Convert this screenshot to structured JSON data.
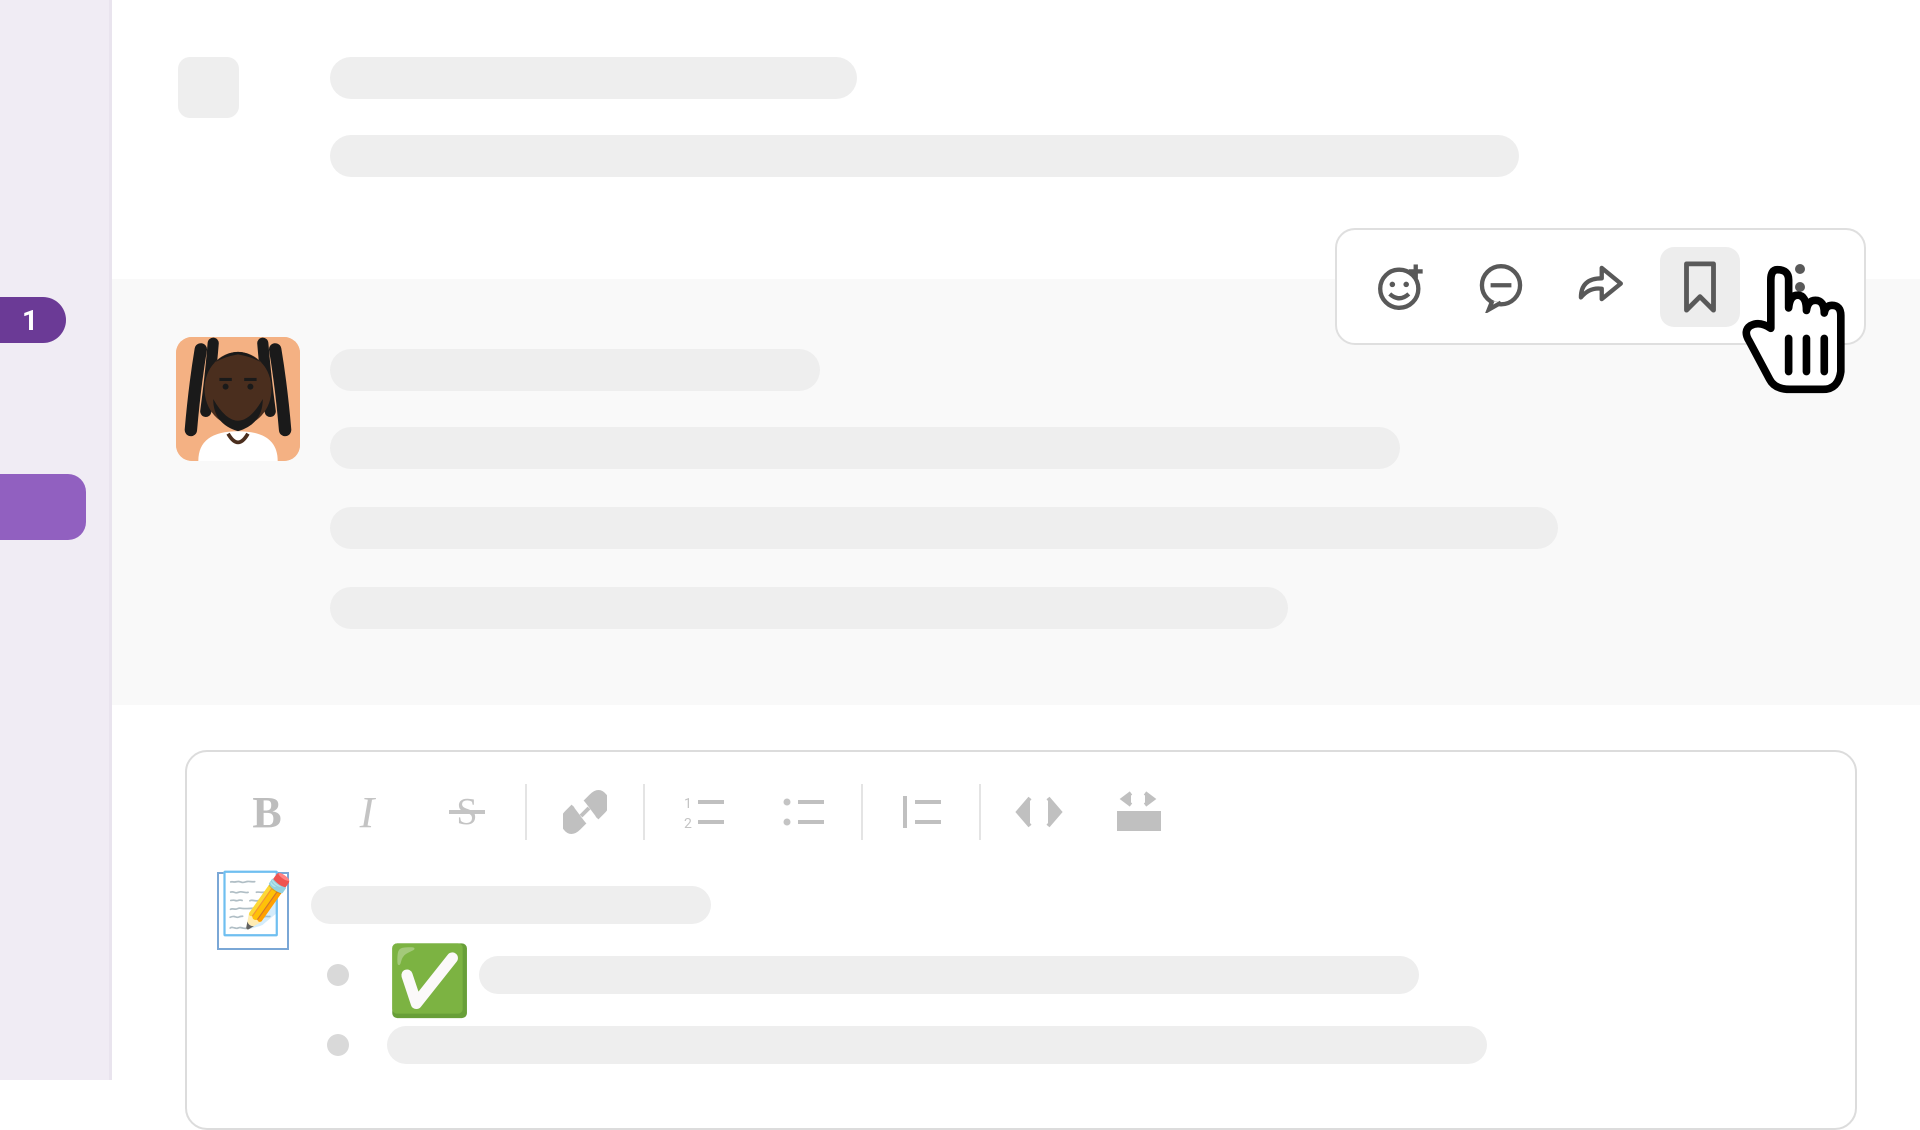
{
  "rail": {
    "badge_count": "1"
  },
  "message_actions": {
    "add_reaction": "add-reaction",
    "reply_thread": "reply-in-thread",
    "share": "share-message",
    "bookmark": "save-bookmark",
    "more": "more-actions"
  },
  "composer": {
    "format_buttons": {
      "bold": "B",
      "italic": "I",
      "strike": "S",
      "link": "link",
      "ordered": "ordered-list",
      "unordered": "unordered-list",
      "quote": "blockquote",
      "code": "code",
      "codeblock": "code-block"
    },
    "content": {
      "memo_emoji": "📝",
      "check_emoji": "✅"
    }
  }
}
